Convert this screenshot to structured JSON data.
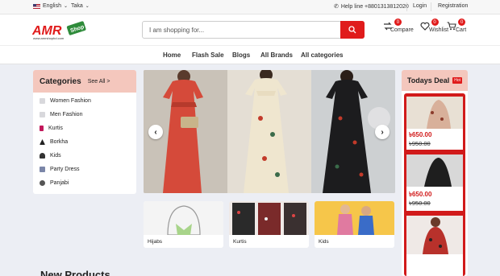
{
  "topbar": {
    "language": "English",
    "currency": "Taka",
    "helpline": "Help line +8801313812020",
    "login": "Login",
    "registration": "Registration"
  },
  "header": {
    "logo_text": "AMR",
    "logo_tag": "Shop",
    "logo_url": "www.amrshopbd.com",
    "search_placeholder": "I am shopping for...",
    "compare": {
      "label": "Compare",
      "count": "0"
    },
    "wishlist": {
      "label": "Wishlist",
      "count": "0"
    },
    "cart": {
      "label": "Cart",
      "count": "0"
    }
  },
  "nav": [
    "Home",
    "Flash Sale",
    "Blogs",
    "All Brands",
    "All categories"
  ],
  "categories": {
    "title": "Categories",
    "see_all": "See All >",
    "items": [
      "Women Fashion",
      "Men Fashion",
      "Kurtis",
      "Borkha",
      "Kids",
      "Party Dress",
      "Panjabi"
    ]
  },
  "tiles": [
    "Hijabs",
    "Kurtis",
    "Kids"
  ],
  "deal": {
    "title": "Todays Deal",
    "badge": "Hot",
    "items": [
      {
        "price": "৳650.00",
        "old": "৳950.00"
      },
      {
        "price": "৳650.00",
        "old": "৳950.00"
      },
      {
        "price": "",
        "old": ""
      }
    ]
  },
  "section_title": "New Products",
  "colors": {
    "accent": "#e01b1b",
    "panel_head": "#f4c7bd",
    "logo_green": "#2e8b3a"
  }
}
